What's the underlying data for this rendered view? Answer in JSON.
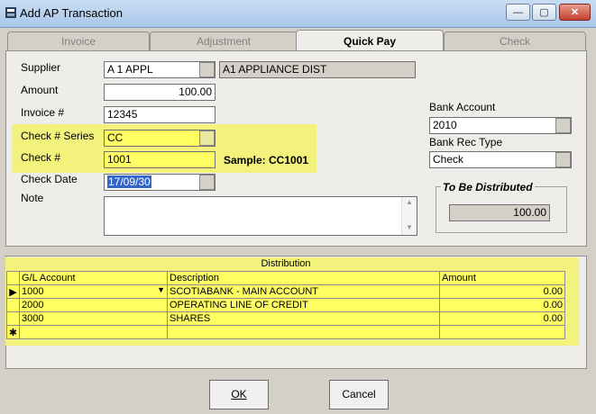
{
  "window": {
    "title": "Add AP Transaction"
  },
  "tabs": [
    {
      "label": "Invoice"
    },
    {
      "label": "Adjustment"
    },
    {
      "label": "Quick Pay"
    },
    {
      "label": "Check"
    }
  ],
  "form": {
    "supplier_label": "Supplier",
    "supplier_code": "A 1 APPL",
    "supplier_name": "A1 APPLIANCE DIST",
    "amount_label": "Amount",
    "amount": "100.00",
    "invoice_label": "Invoice #",
    "invoice": "12345",
    "check_series_label": "Check # Series",
    "check_series": "CC",
    "check_no_label": "Check  #",
    "check_no": "1001",
    "sample_text": "Sample: CC1001",
    "check_date_label": "Check Date",
    "check_date": "17/09/30",
    "note_label": "Note",
    "note": "",
    "bank_account_label": "Bank Account",
    "bank_account": "2010",
    "bank_rec_type_label": "Bank Rec Type",
    "bank_rec_type": "Check",
    "to_be_distributed_label": "To Be Distributed",
    "to_be_distributed": "100.00"
  },
  "distribution": {
    "title": "Distribution",
    "columns": [
      "G/L Account",
      "Description",
      "Amount"
    ],
    "rows": [
      {
        "account": "1000",
        "description": "SCOTIABANK - MAIN ACCOUNT",
        "amount": "0.00"
      },
      {
        "account": "2000",
        "description": "OPERATING LINE OF CREDIT",
        "amount": "0.00"
      },
      {
        "account": "3000",
        "description": "SHARES",
        "amount": "0.00"
      }
    ]
  },
  "buttons": {
    "ok": "OK",
    "cancel": "Cancel"
  },
  "colors": {
    "highlight": "#f2f27c",
    "selection": "#3366cc",
    "titlebar": "#b9d1ee"
  }
}
